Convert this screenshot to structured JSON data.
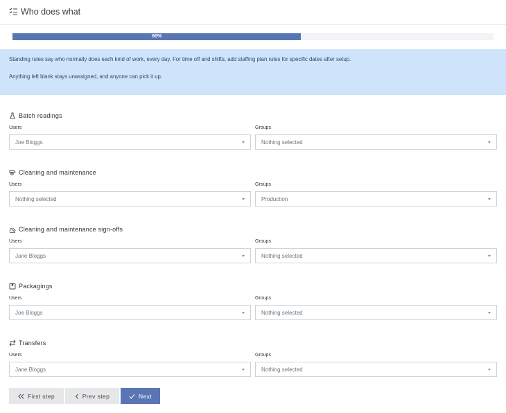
{
  "header": {
    "title": "Who does what",
    "icon": "checklist-icon"
  },
  "progress": {
    "value": 0.6,
    "label": "60%",
    "fill_color": "#5a75b4"
  },
  "info": {
    "line1": "Standing rules say who normally does each kind of work, every day. For time off and shifts, add staffing plan rules for specific dates after setup.",
    "line2": "Anything left blank stays unassigned, and anyone can pick it up."
  },
  "sections": [
    {
      "title": "Batch readings",
      "icon": "flask-icon",
      "users_label": "Users",
      "users_value": "Joe Bloggs",
      "groups_label": "Groups",
      "groups_value": "Nothing selected"
    },
    {
      "title": "Cleaning and maintenance",
      "icon": "broom-icon",
      "users_label": "Users",
      "users_value": "Nothing selected",
      "groups_label": "Groups",
      "groups_value": "Production"
    },
    {
      "title": "Cleaning and maintenance sign-offs",
      "icon": "signature-icon",
      "users_label": "Users",
      "users_value": "Jane Bloggs",
      "groups_label": "Groups",
      "groups_value": "Nothing selected"
    },
    {
      "title": "Packagings",
      "icon": "box-icon",
      "users_label": "Users",
      "users_value": "Joe Bloggs",
      "groups_label": "Groups",
      "groups_value": "Nothing selected"
    },
    {
      "title": "Transfers",
      "icon": "transfer-arrows-icon",
      "users_label": "Users",
      "users_value": "Jane Bloggs",
      "groups_label": "Groups",
      "groups_value": "Nothing selected"
    }
  ],
  "buttons": {
    "first": "First step",
    "prev": "Prev step",
    "next": "Next"
  },
  "colors": {
    "accent": "#5a75b4",
    "info_bg": "#cfe4fa"
  }
}
